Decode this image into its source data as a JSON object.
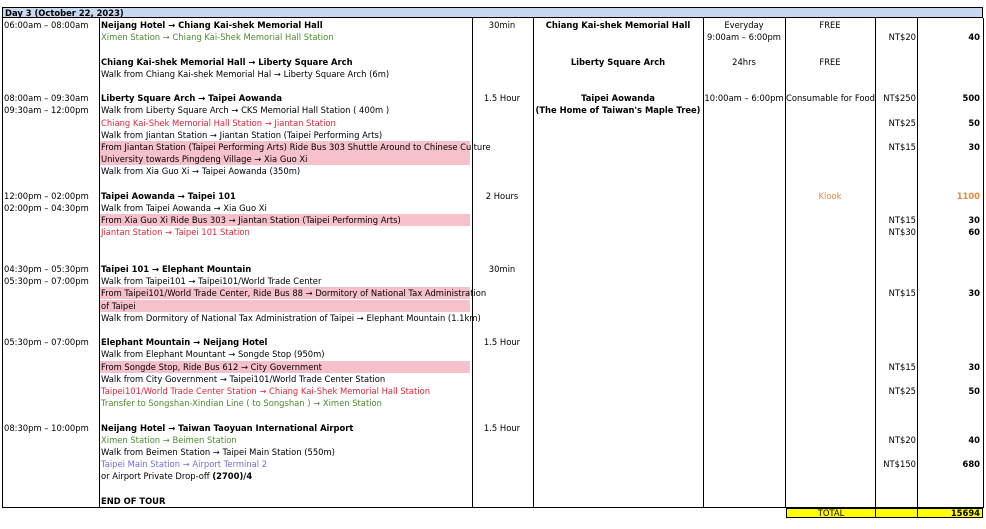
{
  "header": {
    "title": "Day 3 (October 22, 2023)"
  },
  "colors": {
    "header_bg": "#c6d9f1",
    "highlight": "#f7c1cc",
    "total_bg": "#ffff00",
    "green": "#4f8a2c",
    "red": "#e0263a",
    "blue": "#6f6fd8",
    "orange": "#e8883a"
  },
  "rows": [
    {
      "time": "06:00am – 08:00am",
      "route": "Neijang Hotel →   Chiang Kai-shek Memorial Hall",
      "style": "bold",
      "duration": "30min",
      "attraction": "Chiang Kai-shek Memorial Hall",
      "hours": "Everyday",
      "ticket": "FREE",
      "fare": "",
      "amount": ""
    },
    {
      "time": "",
      "route": "Ximen Station → Chiang Kai-Shek Memorial Hall Station",
      "style": "green",
      "duration": "",
      "attraction": "",
      "hours": "9:00am – 6:00pm",
      "ticket": "",
      "fare": "NT$20",
      "amount": "40"
    },
    {
      "time": "",
      "route": "",
      "style": "",
      "duration": "",
      "attraction": "",
      "hours": "",
      "ticket": "",
      "fare": "",
      "amount": ""
    },
    {
      "time": "",
      "route": "Chiang Kai-shek Memorial Hall → Liberty Square Arch",
      "style": "bold",
      "duration": "",
      "attraction": "Liberty Square Arch",
      "hours": "24hrs",
      "ticket": "FREE",
      "fare": "",
      "amount": ""
    },
    {
      "time": "",
      "route": "Walk from Chiang Kai-shek Memorial Hal → Liberty Square Arch (6m)",
      "style": "",
      "duration": "",
      "attraction": "",
      "hours": "",
      "ticket": "",
      "fare": "",
      "amount": ""
    },
    {
      "time": "",
      "route": "",
      "style": "",
      "duration": "",
      "attraction": "",
      "hours": "",
      "ticket": "",
      "fare": "",
      "amount": ""
    },
    {
      "time": "08:00am – 09:30am",
      "route": "Liberty Square Arch → Taipei Aowanda",
      "style": "bold",
      "duration": "1.5 Hour",
      "attraction": "Taipei Aowanda",
      "hours": "10:00am – 6:00pm",
      "ticket": "Consumable for Food",
      "fare": "NT$250",
      "amount": "500"
    },
    {
      "time": "09:30am – 12:00pm",
      "route": "Walk from Liberty Square Arch →   CKS Memorial Hall Station  ( 400m )",
      "style": "",
      "duration": "",
      "attraction": "(The Home of Taiwan's Maple Tree)",
      "hours": "",
      "ticket": "",
      "fare": "",
      "amount": ""
    },
    {
      "time": "",
      "route": "Chiang Kai-Shek Memorial Hall Station → Jiantan Station",
      "style": "red",
      "duration": "",
      "attraction": "",
      "hours": "",
      "ticket": "",
      "fare": "NT$25",
      "amount": "50"
    },
    {
      "time": "",
      "route": "Walk from Jiantan Station →   Jiantan Station (Taipei Performing Arts)",
      "style": "",
      "duration": "",
      "attraction": "",
      "hours": "",
      "ticket": "",
      "fare": "",
      "amount": ""
    },
    {
      "time": "",
      "route": "From Jiantan Station (Taipei Performing Arts) Ride Bus 303 Shuttle Around to Chinese Culture",
      "style": "pink",
      "duration": "",
      "attraction": "",
      "hours": "",
      "ticket": "",
      "fare": "NT$15",
      "amount": "30"
    },
    {
      "time": "",
      "route": "University towards Pingdeng Village →   Xia Guo Xi",
      "style": "pink",
      "duration": "",
      "attraction": "",
      "hours": "",
      "ticket": "",
      "fare": "",
      "amount": ""
    },
    {
      "time": "",
      "route": "Walk from Xia Guo Xi →   Taipei Aowanda (350m)",
      "style": "",
      "duration": "",
      "attraction": "",
      "hours": "",
      "ticket": "",
      "fare": "",
      "amount": ""
    },
    {
      "time": "",
      "route": "",
      "style": "",
      "duration": "",
      "attraction": "",
      "hours": "",
      "ticket": "",
      "fare": "",
      "amount": ""
    },
    {
      "time": "12:00pm – 02:00pm",
      "route": "Taipei Aowanda → Taipei 101",
      "style": "bold",
      "duration": "2 Hours",
      "attraction": "",
      "hours": "",
      "ticket": "Klook",
      "ticket_style": "orange",
      "fare": "",
      "amount": "1100",
      "amount_style": "orange"
    },
    {
      "time": "02:00pm – 04:30pm",
      "route": "Walk from Taipei Aowanda → Xia Guo Xi",
      "style": "",
      "duration": "",
      "attraction": "",
      "hours": "",
      "ticket": "",
      "fare": "",
      "amount": ""
    },
    {
      "time": "",
      "route": "From Xia Guo Xi  Ride Bus 303 → Jiantan Station (Taipei Performing Arts)",
      "style": "pink",
      "duration": "",
      "attraction": "",
      "hours": "",
      "ticket": "",
      "fare": "NT$15",
      "amount": "30"
    },
    {
      "time": "",
      "route": "Jiantan Station → Taipei 101 Station",
      "style": "red",
      "duration": "",
      "attraction": "",
      "hours": "",
      "ticket": "",
      "fare": "NT$30",
      "amount": "60"
    },
    {
      "time": "",
      "route": "",
      "style": "",
      "duration": "",
      "attraction": "",
      "hours": "",
      "ticket": "",
      "fare": "",
      "amount": ""
    },
    {
      "time": "",
      "route": "",
      "style": "",
      "duration": "",
      "attraction": "",
      "hours": "",
      "ticket": "",
      "fare": "",
      "amount": ""
    },
    {
      "time": "04:30pm – 05:30pm",
      "route": "Taipei 101 → Elephant Mountain",
      "style": "bold",
      "duration": "30min",
      "attraction": "",
      "hours": "",
      "ticket": "",
      "fare": "",
      "amount": ""
    },
    {
      "time": "05:30pm – 07:00pm",
      "route": "Walk from Taipei101 →   Taipei101/World Trade Center",
      "style": "",
      "duration": "",
      "attraction": "",
      "hours": "",
      "ticket": "",
      "fare": "",
      "amount": ""
    },
    {
      "time": "",
      "route": "From Taipei101/World Trade Center, Ride Bus 88 → Dormitory of National Tax Administration",
      "style": "pink",
      "duration": "",
      "attraction": "",
      "hours": "",
      "ticket": "",
      "fare": "NT$15",
      "amount": "30"
    },
    {
      "time": "",
      "route": " of Taipei",
      "style": "pink",
      "duration": "",
      "attraction": "",
      "hours": "",
      "ticket": "",
      "fare": "",
      "amount": ""
    },
    {
      "time": "",
      "route": "Walk from Dormitory of National Tax Administration of Taipei → Elephant Mountain (1.1km)",
      "style": "",
      "duration": "",
      "attraction": "",
      "hours": "",
      "ticket": "",
      "fare": "",
      "amount": ""
    },
    {
      "time": "",
      "route": "",
      "style": "",
      "duration": "",
      "attraction": "",
      "hours": "",
      "ticket": "",
      "fare": "",
      "amount": ""
    },
    {
      "time": "05:30pm – 07:00pm",
      "route": "Elephant Mountain → Neijang Hotel",
      "style": "bold",
      "duration": "1.5 Hour",
      "attraction": "",
      "hours": "",
      "ticket": "",
      "fare": "",
      "amount": ""
    },
    {
      "time": "",
      "route": "Walk from Elephant Mountant → Songde Stop  (950m)",
      "style": "",
      "duration": "",
      "attraction": "",
      "hours": "",
      "ticket": "",
      "fare": "",
      "amount": ""
    },
    {
      "time": "",
      "route": "From Songde Stop, Ride Bus 612 → City Government",
      "style": "pink",
      "duration": "",
      "attraction": "",
      "hours": "",
      "ticket": "",
      "fare": "NT$15",
      "amount": "30"
    },
    {
      "time": "",
      "route": "Walk from City Government →   Taipei101/World Trade Center Station",
      "style": "",
      "duration": "",
      "attraction": "",
      "hours": "",
      "ticket": "",
      "fare": "",
      "amount": ""
    },
    {
      "time": "",
      "route": "Taipei101/World Trade Center Station → Chiang Kai-Shek Memorial Hall Station",
      "style": "red",
      "duration": "",
      "attraction": "",
      "hours": "",
      "ticket": "",
      "fare": "NT$25",
      "amount": "50"
    },
    {
      "time": "",
      "route": "Transfer to Songshan-Xindian Line ( to Songshan ) → Ximen Station",
      "style": "green",
      "duration": "",
      "attraction": "",
      "hours": "",
      "ticket": "",
      "fare": "",
      "amount": ""
    },
    {
      "time": "",
      "route": "",
      "style": "",
      "duration": "",
      "attraction": "",
      "hours": "",
      "ticket": "",
      "fare": "",
      "amount": ""
    },
    {
      "time": "08:30pm – 10:00pm",
      "route": "Neijang Hotel → Taiwan Taoyuan International Airport",
      "style": "bold",
      "duration": "1.5 Hour",
      "attraction": "",
      "hours": "",
      "ticket": "",
      "fare": "",
      "amount": ""
    },
    {
      "time": "",
      "route": "Ximen Station → Beimen Station",
      "style": "green",
      "duration": "",
      "attraction": "",
      "hours": "",
      "ticket": "",
      "fare": "NT$20",
      "amount": "40"
    },
    {
      "time": "",
      "route": "Walk from Beimen Station → Taipei Main Station (550m)",
      "style": "",
      "duration": "",
      "attraction": "",
      "hours": "",
      "ticket": "",
      "fare": "",
      "amount": ""
    },
    {
      "time": "",
      "route": "Taipei Main Station → Airport Terminal 2",
      "style": "blue",
      "duration": "",
      "attraction": "",
      "hours": "",
      "ticket": "",
      "fare": "NT$150",
      "amount": "680"
    },
    {
      "time": "",
      "route": "or Airport Private Drop-off ",
      "route_bold": "(2700)/4",
      "style": "",
      "duration": "",
      "attraction": "",
      "hours": "",
      "ticket": "",
      "fare": "",
      "amount": ""
    },
    {
      "time": "",
      "route": "",
      "style": "",
      "duration": "",
      "attraction": "",
      "hours": "",
      "ticket": "",
      "fare": "",
      "amount": ""
    },
    {
      "time": "",
      "route": "END OF TOUR",
      "style": "bold",
      "duration": "",
      "attraction": "",
      "hours": "",
      "ticket": "",
      "fare": "",
      "amount": ""
    }
  ],
  "total": {
    "label": "TOTAL",
    "amount": "15694"
  }
}
